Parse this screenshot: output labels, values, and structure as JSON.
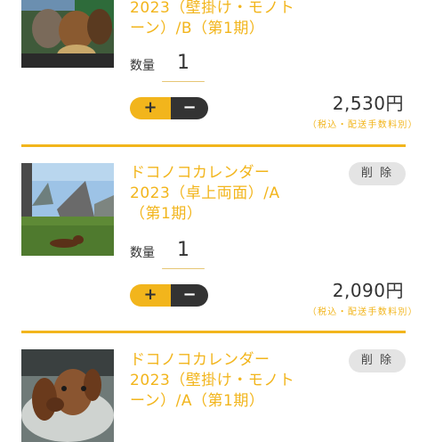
{
  "items": [
    {
      "title": "2023（壁掛け・モノト\nーン）/B（第1期）",
      "qty_label": "数量",
      "qty": "1",
      "plus": "+",
      "minus": "−",
      "price": "2,530円",
      "price_note": "（税込・配送手数料別）",
      "thumb_icon": "dogs-car-photo"
    },
    {
      "title": "ドコノコカレンダー\n2023（卓上両面）/A\n（第1期）",
      "delete": "削 除",
      "qty_label": "数量",
      "qty": "1",
      "plus": "+",
      "minus": "−",
      "price": "2,090円",
      "price_note": "（税込・配送手数料別）",
      "thumb_icon": "dog-lawn-photo"
    },
    {
      "title": "ドコノコカレンダー\n2023（壁掛け・モノト\nーン）/A（第1期）",
      "delete": "削 除",
      "thumb_icon": "dachshund-basket-photo"
    }
  ],
  "colors": {
    "accent": "#f2b51c",
    "dark": "#333333",
    "delete_bg": "#e4e4e4"
  }
}
